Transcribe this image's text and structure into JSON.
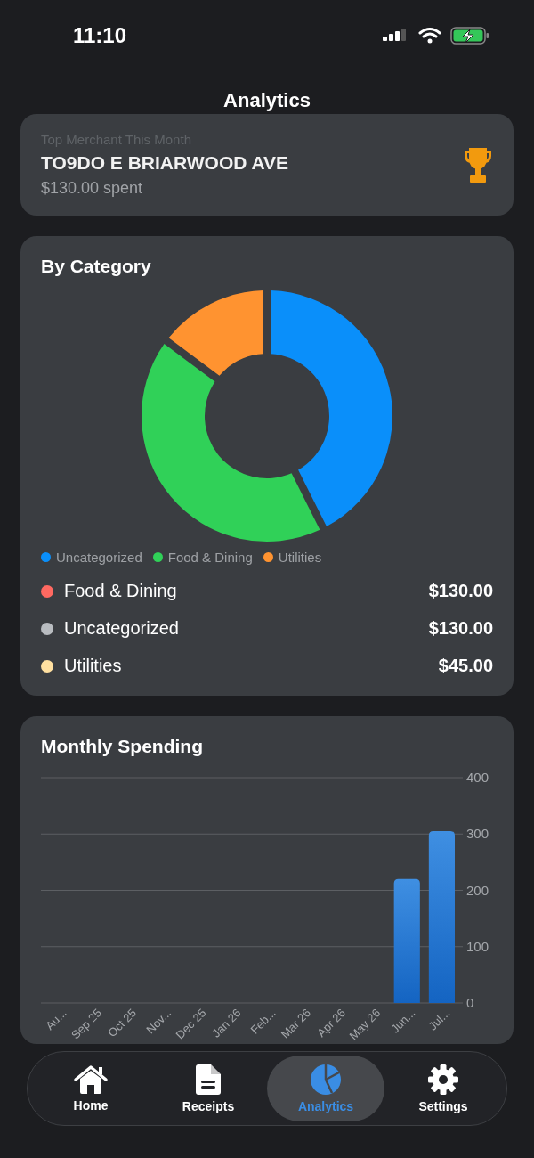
{
  "status_bar": {
    "time": "11:10"
  },
  "title": "Analytics",
  "top_merchant": {
    "caption": "Top Merchant This Month",
    "name": "TO9DO E BRIARWOOD AVE",
    "amount": "$130.00 spent"
  },
  "by_category": {
    "title": "By Category",
    "chart_data": {
      "type": "donut",
      "categories": [
        "Uncategorized",
        "Food & Dining",
        "Utilities"
      ],
      "values": [
        42.6,
        42.6,
        14.8
      ],
      "colors": [
        "#0a8ffa",
        "#30d158",
        "#ff9330"
      ]
    },
    "items": [
      {
        "name": "Food & Dining",
        "amount": "$130.00",
        "color": "#ff6961"
      },
      {
        "name": "Uncategorized",
        "amount": "$130.00",
        "color": "#b8bcc0"
      },
      {
        "name": "Utilities",
        "amount": "$45.00",
        "color": "#ffe0a0"
      }
    ]
  },
  "monthly": {
    "title": "Monthly Spending",
    "chart_data": {
      "type": "bar",
      "categories": [
        "Au...",
        "Sep 25",
        "Oct 25",
        "Nov...",
        "Dec 25",
        "Jan 26",
        "Feb...",
        "Mar 26",
        "Apr 26",
        "May 26",
        "Jun...",
        "Jul..."
      ],
      "values": [
        0,
        0,
        0,
        0,
        0,
        0,
        0,
        0,
        0,
        0,
        220,
        305
      ],
      "ylim": [
        0,
        400
      ],
      "yticks": [
        0,
        100,
        200,
        300,
        400
      ],
      "grid": true
    }
  },
  "tabs": [
    {
      "label": "Home",
      "selected": false
    },
    {
      "label": "Receipts",
      "selected": false
    },
    {
      "label": "Analytics",
      "selected": true
    },
    {
      "label": "Settings",
      "selected": false
    }
  ]
}
